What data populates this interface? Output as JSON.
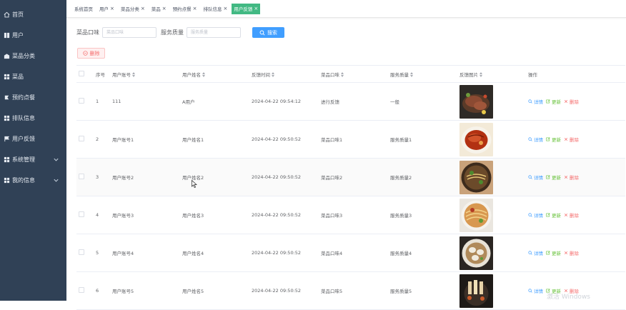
{
  "sidebar": {
    "items": [
      {
        "label": "首页",
        "icon": "home-icon"
      },
      {
        "label": "用户",
        "icon": "user-icon"
      },
      {
        "label": "菜品分类",
        "icon": "category-icon"
      },
      {
        "label": "菜品",
        "icon": "dish-icon"
      },
      {
        "label": "预约点餐",
        "icon": "reserve-icon"
      },
      {
        "label": "排队信息",
        "icon": "queue-icon"
      },
      {
        "label": "用户反馈",
        "icon": "feedback-icon"
      },
      {
        "label": "系统管理",
        "icon": "settings-icon"
      },
      {
        "label": "我的信息",
        "icon": "profile-icon"
      }
    ]
  },
  "tags": {
    "items": [
      {
        "label": "系统首页",
        "closable": false
      },
      {
        "label": "用户",
        "closable": true
      },
      {
        "label": "菜品分类",
        "closable": true
      },
      {
        "label": "菜品",
        "closable": true
      },
      {
        "label": "预约点餐",
        "closable": true
      },
      {
        "label": "排队信息",
        "closable": true
      },
      {
        "label": "用户反馈",
        "closable": true
      }
    ],
    "close_glyph": "×"
  },
  "search": {
    "taste_label": "菜品口味",
    "taste_placeholder": "菜品口味",
    "service_label": "服务质量",
    "service_placeholder": "服务质量",
    "button_label": "搜索"
  },
  "toolbar": {
    "delete_label": "删除"
  },
  "table": {
    "columns": [
      "序号",
      "用户账号",
      "用户姓名",
      "反馈时间",
      "菜品口味",
      "服务质量",
      "反馈图片",
      "操作"
    ],
    "rows": [
      {
        "index": "1",
        "account": "111",
        "name": "A用户",
        "time": "2024-04-22 09:54:12",
        "taste": "进行反馈",
        "service": "一般",
        "image": "steak-dish"
      },
      {
        "index": "2",
        "account": "用户账号1",
        "name": "用户姓名1",
        "time": "2024-04-22 09:50:52",
        "taste": "菜品口味1",
        "service": "服务质量1",
        "image": "braised-fish-dish"
      },
      {
        "index": "3",
        "account": "用户账号2",
        "name": "用户姓名2",
        "time": "2024-04-22 09:50:52",
        "taste": "菜品口味2",
        "service": "服务质量2",
        "image": "noodle-soup-dish"
      },
      {
        "index": "4",
        "account": "用户账号3",
        "name": "用户姓名3",
        "time": "2024-04-22 09:50:52",
        "taste": "菜品口味3",
        "service": "服务质量3",
        "image": "noodle-bowl-dish"
      },
      {
        "index": "5",
        "account": "用户账号4",
        "name": "用户姓名4",
        "time": "2024-04-22 09:50:52",
        "taste": "菜品口味4",
        "service": "服务质量4",
        "image": "dumpling-soup-dish"
      },
      {
        "index": "6",
        "account": "用户账号5",
        "name": "用户姓名5",
        "time": "2024-04-22 09:50:52",
        "taste": "菜品口味5",
        "service": "服务质量5",
        "image": "skewers-dish"
      }
    ],
    "ops": {
      "detail": "详情",
      "update": "更新",
      "delete": "删除"
    }
  },
  "watermark": "激活 Windows",
  "colors": {
    "sidebar_bg": "#304156",
    "active_tag": "#42b983",
    "primary": "#409eff",
    "success": "#67c23a",
    "danger": "#f56c6c"
  }
}
